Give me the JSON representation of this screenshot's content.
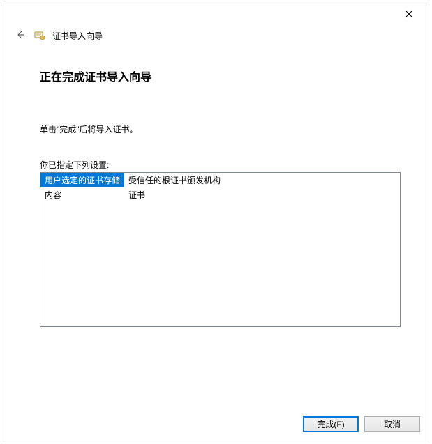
{
  "titlebar": {
    "close_label": "Close"
  },
  "header": {
    "back_label": "Back",
    "wizard_title": "证书导入向导"
  },
  "content": {
    "heading": "正在完成证书导入向导",
    "instruction": "单击\"完成\"后将导入证书。",
    "settings_label": "你已指定下列设置:",
    "settings_rows": [
      {
        "key": "用户选定的证书存储",
        "value": "受信任的根证书颁发机构"
      },
      {
        "key": "内容",
        "value": "证书"
      }
    ]
  },
  "footer": {
    "finish_label": "完成(F)",
    "cancel_label": "取消"
  }
}
